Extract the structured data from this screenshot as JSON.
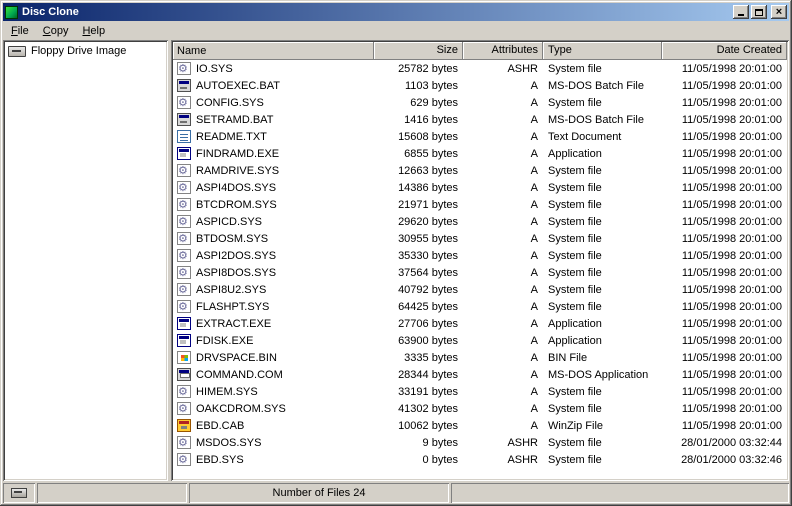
{
  "window": {
    "title": "Disc Clone"
  },
  "menu": {
    "items": [
      {
        "label": "File"
      },
      {
        "label": "Copy"
      },
      {
        "label": "Help"
      }
    ]
  },
  "tree": {
    "items": [
      {
        "label": "Floppy Drive Image",
        "icon": "floppy-drive-icon"
      }
    ]
  },
  "list": {
    "columns": [
      {
        "label": "Name",
        "align": "left"
      },
      {
        "label": "Size",
        "align": "right"
      },
      {
        "label": "Attributes",
        "align": "right"
      },
      {
        "label": "Type",
        "align": "left"
      },
      {
        "label": "Date Created",
        "align": "right"
      }
    ],
    "rows": [
      {
        "icon": "system-file-icon",
        "name": "IO.SYS",
        "size": "25782 bytes",
        "attributes": "ASHR",
        "type": "System file",
        "date": "11/05/1998 20:01:00"
      },
      {
        "icon": "batch-file-icon",
        "name": "AUTOEXEC.BAT",
        "size": "1103 bytes",
        "attributes": "A",
        "type": "MS-DOS Batch File",
        "date": "11/05/1998 20:01:00"
      },
      {
        "icon": "system-file-icon",
        "name": "CONFIG.SYS",
        "size": "629 bytes",
        "attributes": "A",
        "type": "System file",
        "date": "11/05/1998 20:01:00"
      },
      {
        "icon": "batch-file-icon",
        "name": "SETRAMD.BAT",
        "size": "1416 bytes",
        "attributes": "A",
        "type": "MS-DOS Batch File",
        "date": "11/05/1998 20:01:00"
      },
      {
        "icon": "text-file-icon",
        "name": "README.TXT",
        "size": "15608 bytes",
        "attributes": "A",
        "type": "Text Document",
        "date": "11/05/1998 20:01:00"
      },
      {
        "icon": "application-icon",
        "name": "FINDRAMD.EXE",
        "size": "6855 bytes",
        "attributes": "A",
        "type": "Application",
        "date": "11/05/1998 20:01:00"
      },
      {
        "icon": "system-file-icon",
        "name": "RAMDRIVE.SYS",
        "size": "12663 bytes",
        "attributes": "A",
        "type": "System file",
        "date": "11/05/1998 20:01:00"
      },
      {
        "icon": "system-file-icon",
        "name": "ASPI4DOS.SYS",
        "size": "14386 bytes",
        "attributes": "A",
        "type": "System file",
        "date": "11/05/1998 20:01:00"
      },
      {
        "icon": "system-file-icon",
        "name": "BTCDROM.SYS",
        "size": "21971 bytes",
        "attributes": "A",
        "type": "System file",
        "date": "11/05/1998 20:01:00"
      },
      {
        "icon": "system-file-icon",
        "name": "ASPICD.SYS",
        "size": "29620 bytes",
        "attributes": "A",
        "type": "System file",
        "date": "11/05/1998 20:01:00"
      },
      {
        "icon": "system-file-icon",
        "name": "BTDOSM.SYS",
        "size": "30955 bytes",
        "attributes": "A",
        "type": "System file",
        "date": "11/05/1998 20:01:00"
      },
      {
        "icon": "system-file-icon",
        "name": "ASPI2DOS.SYS",
        "size": "35330 bytes",
        "attributes": "A",
        "type": "System file",
        "date": "11/05/1998 20:01:00"
      },
      {
        "icon": "system-file-icon",
        "name": "ASPI8DOS.SYS",
        "size": "37564 bytes",
        "attributes": "A",
        "type": "System file",
        "date": "11/05/1998 20:01:00"
      },
      {
        "icon": "system-file-icon",
        "name": "ASPI8U2.SYS",
        "size": "40792 bytes",
        "attributes": "A",
        "type": "System file",
        "date": "11/05/1998 20:01:00"
      },
      {
        "icon": "system-file-icon",
        "name": "FLASHPT.SYS",
        "size": "64425 bytes",
        "attributes": "A",
        "type": "System file",
        "date": "11/05/1998 20:01:00"
      },
      {
        "icon": "application-icon",
        "name": "EXTRACT.EXE",
        "size": "27706 bytes",
        "attributes": "A",
        "type": "Application",
        "date": "11/05/1998 20:01:00"
      },
      {
        "icon": "application-icon",
        "name": "FDISK.EXE",
        "size": "63900 bytes",
        "attributes": "A",
        "type": "Application",
        "date": "11/05/1998 20:01:00"
      },
      {
        "icon": "bin-file-icon",
        "name": "DRVSPACE.BIN",
        "size": "3335 bytes",
        "attributes": "A",
        "type": "BIN File",
        "date": "11/05/1998 20:01:00"
      },
      {
        "icon": "dos-application-icon",
        "name": "COMMAND.COM",
        "size": "28344 bytes",
        "attributes": "A",
        "type": "MS-DOS Application",
        "date": "11/05/1998 20:01:00"
      },
      {
        "icon": "system-file-icon",
        "name": "HIMEM.SYS",
        "size": "33191 bytes",
        "attributes": "A",
        "type": "System file",
        "date": "11/05/1998 20:01:00"
      },
      {
        "icon": "system-file-icon",
        "name": "OAKCDROM.SYS",
        "size": "41302 bytes",
        "attributes": "A",
        "type": "System file",
        "date": "11/05/1998 20:01:00"
      },
      {
        "icon": "winzip-file-icon",
        "name": "EBD.CAB",
        "size": "10062 bytes",
        "attributes": "A",
        "type": "WinZip File",
        "date": "11/05/1998 20:01:00"
      },
      {
        "icon": "system-file-icon",
        "name": "MSDOS.SYS",
        "size": "9 bytes",
        "attributes": "ASHR",
        "type": "System file",
        "date": "28/01/2000 03:32:44"
      },
      {
        "icon": "system-file-icon",
        "name": "EBD.SYS",
        "size": "0 bytes",
        "attributes": "ASHR",
        "type": "System file",
        "date": "28/01/2000 03:32:46"
      }
    ]
  },
  "statusbar": {
    "files_label": "Number of Files 24"
  },
  "icons": {
    "close": "×"
  },
  "colors": {
    "titlebar_left": "#0A246A",
    "titlebar_right": "#A6CAF0",
    "window_face": "#D4D0C8",
    "app_icon_green": "#00A651"
  }
}
